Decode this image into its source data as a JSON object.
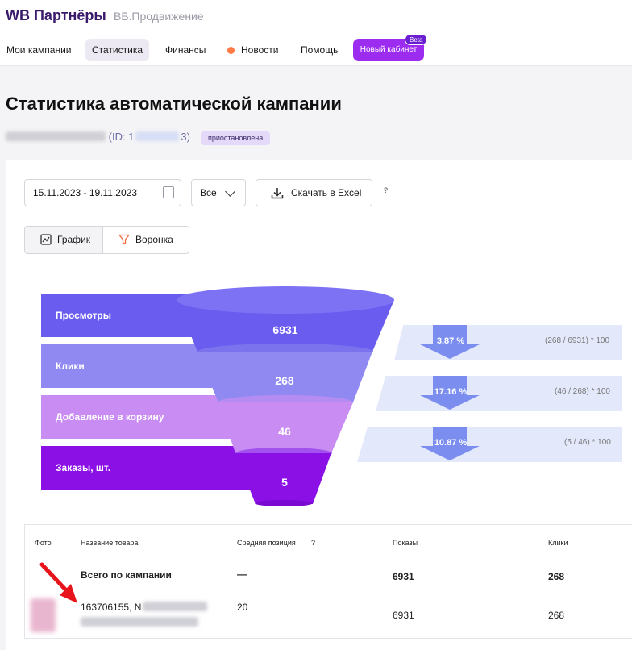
{
  "header": {
    "logo": "WB Партнёры",
    "subtitle": "ВБ.Продвижение",
    "nav": [
      "Мои кампании",
      "Статистика",
      "Финансы",
      "Новости",
      "Помощь"
    ],
    "new_cabinet": "Новый кабинет",
    "beta": "Beta"
  },
  "page": {
    "title": "Статистика автоматической кампании",
    "campaign_id_label": "(ID: 1",
    "campaign_id_end": "3)",
    "status": "приостановлена"
  },
  "controls": {
    "date_range": "15.11.2023 - 19.11.2023",
    "filter_value": "Все",
    "excel_label": "Скачать в Excel",
    "help": "?",
    "view_chart": "График",
    "view_funnel": "Воронка"
  },
  "funnel": {
    "stages": [
      {
        "label": "Просмотры",
        "value": "6931"
      },
      {
        "label": "Клики",
        "value": "268"
      },
      {
        "label": "Добавление в корзину",
        "value": "46"
      },
      {
        "label": "Заказы, шт.",
        "value": "5"
      }
    ],
    "conversions": [
      {
        "percent": "3.87 %",
        "formula": "(268 / 6931) * 100"
      },
      {
        "percent": "17.16 %",
        "formula": "(46 / 268) * 100"
      },
      {
        "percent": "10.87 %",
        "formula": "(5 / 46) * 100"
      }
    ],
    "colors": {
      "views": "#6b5cf0",
      "clicks": "#9189f2",
      "cart": "#c98cf3",
      "orders": "#8a10e6",
      "conversion_band": "#e4e8fb",
      "conversion_arrow": "#7b8ef0"
    }
  },
  "table": {
    "headers": [
      "Фото",
      "Название товара",
      "Средняя позиция",
      "?",
      "Показы",
      "Клики"
    ],
    "total_row": {
      "name": "Всего по кампании",
      "position": "—",
      "views": "6931",
      "clicks": "268"
    },
    "item_row": {
      "name": "163706155, N",
      "position": "20",
      "views": "6931",
      "clicks": "268"
    }
  }
}
